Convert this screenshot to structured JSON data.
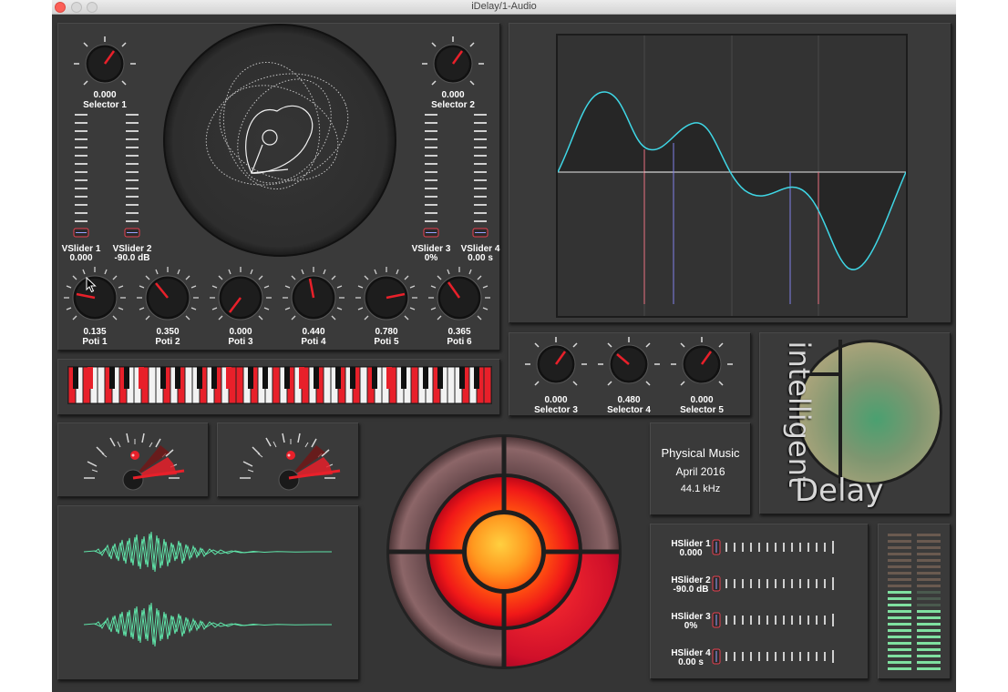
{
  "window": {
    "title": "iDelay/1-Audio"
  },
  "selectors_top": [
    {
      "value": "0.000",
      "label": "Selector 1"
    },
    {
      "value": "0.000",
      "label": "Selector 2"
    }
  ],
  "vsliders": [
    {
      "label": "VSlider 1",
      "value": "0.000"
    },
    {
      "label": "VSlider 2",
      "value": "-90.0 dB"
    },
    {
      "label": "VSlider 3",
      "value": "0%"
    },
    {
      "label": "VSlider 4",
      "value": "0.00 s"
    }
  ],
  "potis": [
    {
      "value": "0.135",
      "label": "Poti 1",
      "level": 0.135
    },
    {
      "value": "0.350",
      "label": "Poti 2",
      "level": 0.35
    },
    {
      "value": "0.000",
      "label": "Poti 3",
      "level": 0.0
    },
    {
      "value": "0.440",
      "label": "Poti 4",
      "level": 0.44
    },
    {
      "value": "0.780",
      "label": "Poti 5",
      "level": 0.78
    },
    {
      "value": "0.365",
      "label": "Poti 6",
      "level": 0.365
    }
  ],
  "selectors_mid": [
    {
      "value": "0.000",
      "label": "Selector 3"
    },
    {
      "value": "0.480",
      "label": "Selector 4"
    },
    {
      "value": "0.000",
      "label": "Selector 5"
    }
  ],
  "info": {
    "line1": "Physical Music",
    "line2": "April 2016",
    "line3": "44.1 kHz"
  },
  "logo": {
    "word1": "intelligent",
    "word2": "Delay"
  },
  "hsliders": [
    {
      "label": "HSlider 1",
      "value": "0.000"
    },
    {
      "label": "HSlider 2",
      "value": "-90.0 dB"
    },
    {
      "label": "HSlider 3",
      "value": "0%"
    },
    {
      "label": "HSlider 4",
      "value": "0.00 s"
    }
  ],
  "colors": {
    "background": "#353535",
    "panel": "#3a3a3a",
    "accent_red": "#e8202a",
    "waveform_green": "#5fe3a8",
    "curve_cyan": "#3fd7e6",
    "meter_green": "#7fe0a0"
  }
}
